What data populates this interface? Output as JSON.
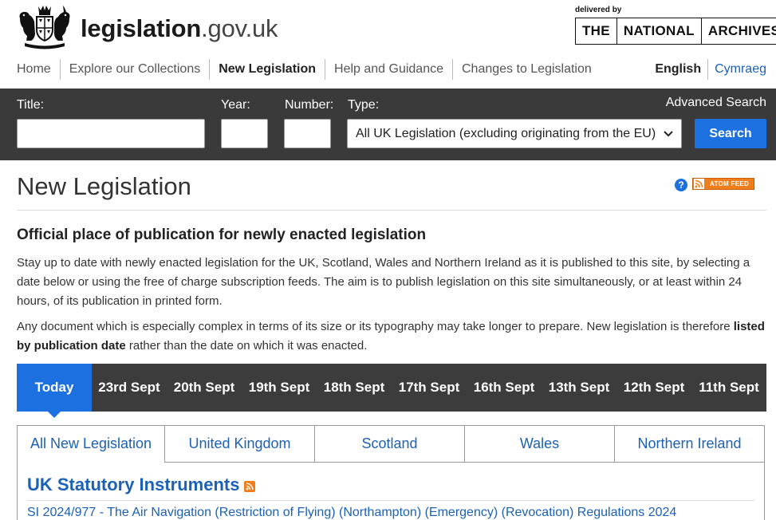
{
  "header": {
    "site_name_bold": "legislation",
    "site_name_rest": ".gov.uk",
    "delivered_by": "delivered by",
    "tna_logo": [
      "THE",
      "NATIONAL",
      "ARCHIVES"
    ]
  },
  "nav": {
    "items": [
      "Home",
      "Explore our Collections",
      "New Legislation",
      "Help and Guidance",
      "Changes to Legislation"
    ],
    "active": "New Legislation"
  },
  "language": {
    "current": "English",
    "alternate": "Cymraeg"
  },
  "search": {
    "title_label": "Title:",
    "title_value": "",
    "year_label": "Year:",
    "year_value": "",
    "number_label": "Number:",
    "number_value": "",
    "type_label": "Type:",
    "type_selected": "All UK Legislation (excluding originating from the EU)",
    "advanced_label": "Advanced Search",
    "search_button": "Search"
  },
  "page": {
    "title": "New Legislation",
    "help_icon": "?",
    "atom_feed": "ATOM FEED"
  },
  "intro": {
    "heading": "Official place of publication for newly enacted legislation",
    "paragraph1": "Stay up to date with newly enacted legislation for the UK, Scotland, Wales and Northern Ireland as it is published to this site, by selecting a date below or using the free of charge subscription feeds. The aim is to publish legislation on this site simultaneously, or at least within 24 hours, of its publication in printed form.",
    "paragraph2_before": "Any document which is especially complex in terms of its size or its typography may take longer to prepare. New legislation is therefore ",
    "paragraph2_bold": "listed by publication date",
    "paragraph2_after": " rather than the date on which it was enacted."
  },
  "date_tabs": {
    "today": "Today",
    "dates": [
      "23rd Sept",
      "20th Sept",
      "19th Sept",
      "18th Sept",
      "17th Sept",
      "16th Sept",
      "13th Sept",
      "12th Sept",
      "11th Sept"
    ]
  },
  "region_tabs": {
    "items": [
      "All New Legislation",
      "United Kingdom",
      "Scotland",
      "Wales",
      "Northern Ireland"
    ],
    "active": "All New Legislation"
  },
  "results": {
    "section_heading": "UK Statutory Instruments",
    "first_item": "SI 2024/977 - The Air Navigation (Restriction of Flying) (Northampton) (Emergency) (Revocation) Regulations 2024"
  },
  "colors": {
    "accent_blue": "#1d70e0",
    "link_blue": "#1b61b7",
    "search_bar_bg": "#3a3a3a",
    "date_bar_bg": "#3c3c3c",
    "feed_orange": "#f07f1b"
  },
  "icons": [
    "royal-crest-icon",
    "help-question-icon",
    "rss-feed-icon",
    "chevron-down-icon"
  ]
}
